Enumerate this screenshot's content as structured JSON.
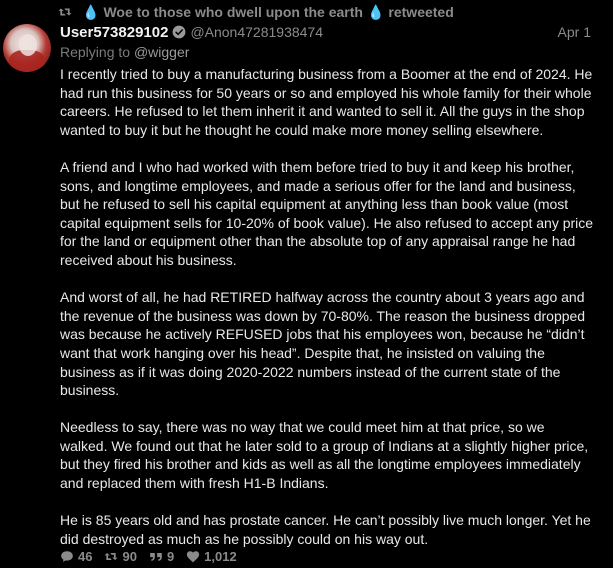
{
  "retweet": {
    "text": "Woe to those who dwell upon the earth",
    "suffix": "retweeted",
    "drop_emoji": "💧"
  },
  "tweet": {
    "username": "User573829102",
    "handle": "@Anon47281938474",
    "date": "Apr 1",
    "verified": true,
    "reply_prefix": "Replying to",
    "reply_to": "@wigger",
    "paragraphs": [
      "I recently tried to buy a manufacturing business from a Boomer at the end of 2024. He had run this business for 50 years or so and employed his whole family for their whole careers. He refused to let them inherit it and wanted to sell it. All the guys in the shop wanted to buy it but he thought he could make more money selling elsewhere.",
      "A friend and I who had worked with them before tried to buy it and keep his brother, sons, and longtime employees, and made a serious offer for the land and business, but he refused to sell his capital equipment at anything less than book value (most capital equipment sells for 10-20% of book value). He also refused to accept any price for the land or equipment other than the absolute top of any appraisal range he had received about his business.",
      "And worst of all, he had RETIRED halfway across the country about 3 years ago and the revenue of the business was down by 70-80%. The reason the business dropped was because he actively REFUSED jobs that his employees won, because he “didn’t want that work hanging over his head”. Despite that, he insisted on valuing the business as if it was doing 2020-2022 numbers instead of the current state of the business.",
      "Needless to say, there was no way that we could meet him at that price, so we walked. We found out that he later sold to a group of Indians at a slightly higher price, but they fired his brother and kids as well as all the longtime employees immediately and replaced them with fresh H1-B Indians.",
      "He is 85 years old and has prostate cancer. He can’t possibly live much longer. Yet he did destroyed as much as he possibly could on his way out."
    ]
  },
  "actions": {
    "replies": "46",
    "retweets": "90",
    "quotes": "9",
    "likes": "1,012"
  },
  "colors": {
    "background": "#000000",
    "text": "#e8e8e8",
    "muted": "#8b8b8b",
    "verified": "#9a9a9a"
  }
}
